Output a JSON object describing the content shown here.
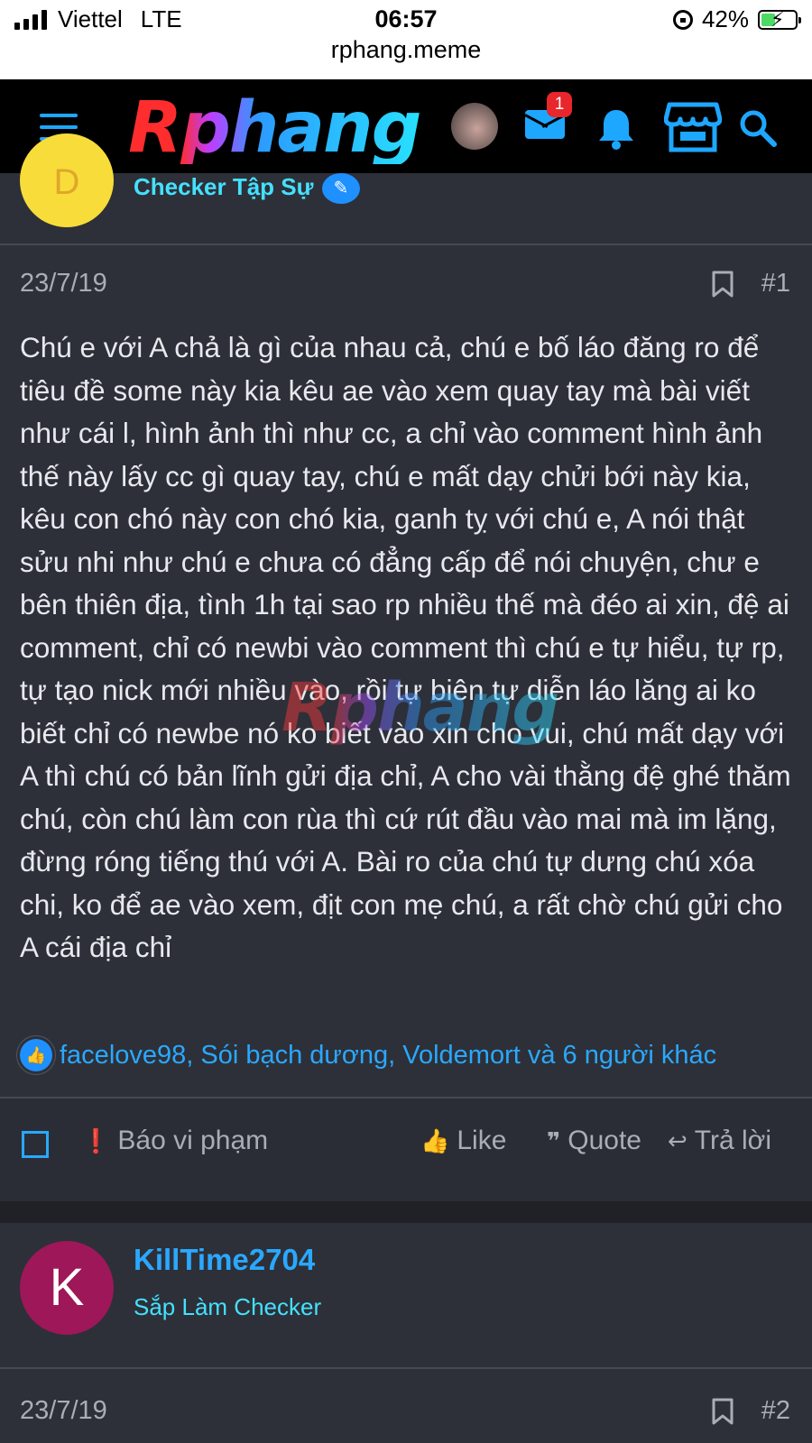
{
  "status_bar": {
    "carrier": "Viettel",
    "network": "LTE",
    "time": "06:57",
    "url": "rphang.meme",
    "battery": "42%"
  },
  "header": {
    "logo": "Rphang",
    "mail_badge": "1"
  },
  "post1": {
    "author_rank": "Checker Tập Sự",
    "date": "23/7/19",
    "number": "#1",
    "body": "Chú e với A chả là gì của nhau cả, chú e bố láo đăng ro để tiêu đề some này kia kêu ae vào xem quay tay mà bài viết như cái l, hình ảnh thì như cc, a chỉ vào comment hình ảnh thế này lấy cc gì quay tay, chú e mất dạy chửi bới này kia, kêu con chó này con chó kia, ganh tỵ với chú e, A nói thật sửu nhi như chú e chưa có đẳng cấp để nói chuyện, chư e bên thiên địa, tình 1h tại sao rp nhiều thế mà đéo ai xin, đệ ai comment, chỉ có newbi vào comment thì chú e tự hiểu, tự rp, tự tạo nick mới nhiều vào, rồi tự biên tự diễn láo lăng ai ko biết chỉ có newbe nó ko biết vào xin cho vui, chú mất dạy với A thì chú có bản lĩnh gửi địa chỉ, A cho vài thằng đệ ghé thăm chú, còn chú làm con rùa thì cứ rút đầu vào mai mà im lặng, đừng róng tiếng thú với A. Bài ro của chú tự dưng chú xóa chi, ko để ae vào xem, địt con mẹ chú, a rất chờ chú gửi cho A cái địa chỉ",
    "reactions": "facelove98, Sói bạch dương, Voldemort và 6 người khác",
    "actions": {
      "report": "Báo vi phạm",
      "like": "Like",
      "quote": "Quote",
      "reply": "Trả lời"
    }
  },
  "post2": {
    "avatar_letter": "K",
    "author": "KillTime2704",
    "author_rank": "Sắp Làm Checker",
    "date": "23/7/19",
    "number": "#2"
  }
}
